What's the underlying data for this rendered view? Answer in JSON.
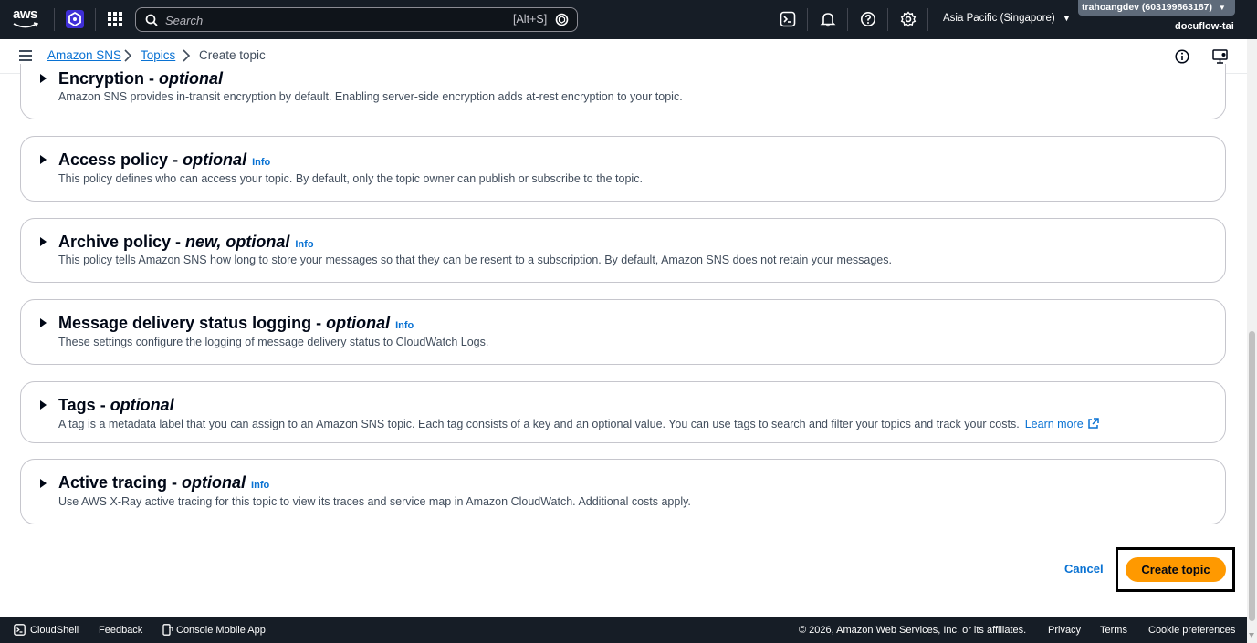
{
  "topnav": {
    "logo": "aws",
    "search_placeholder": "Search",
    "search_shortcut": "[Alt+S]",
    "region": "Asia Pacific (Singapore)",
    "account": "trahoangdev (603199863187)",
    "user": "docuflow-tai",
    "icons": [
      "cloudshell-icon",
      "bell-icon",
      "help-icon",
      "settings-icon"
    ]
  },
  "breadcrumb": {
    "items": [
      "Amazon SNS",
      "Topics"
    ],
    "current": "Create topic"
  },
  "panels": [
    {
      "title": "Encryption",
      "sep": " - ",
      "optional": "optional",
      "info": "",
      "description": "Amazon SNS provides in-transit encryption by default. Enabling server-side encryption adds at-rest encryption to your topic."
    },
    {
      "title": "Access policy",
      "sep": " - ",
      "optional": "optional",
      "info": "Info",
      "description": "This policy defines who can access your topic. By default, only the topic owner can publish or subscribe to the topic."
    },
    {
      "title": "Archive policy",
      "sep": " - ",
      "optional": "new, optional",
      "info": "Info",
      "description": "This policy tells Amazon SNS how long to store your messages so that they can be resent to a subscription. By default, Amazon SNS does not retain your messages."
    },
    {
      "title": "Message delivery status logging",
      "sep": " - ",
      "optional": "optional",
      "info": "Info",
      "description": "These settings configure the logging of message delivery status to CloudWatch Logs."
    },
    {
      "title": "Tags",
      "sep": " - ",
      "optional": "optional",
      "info": "",
      "description": "A tag is a metadata label that you can assign to an Amazon SNS topic. Each tag consists of a key and an optional value. You can use tags to search and filter your topics and track your costs.",
      "link": "Learn more"
    },
    {
      "title": "Active tracing",
      "sep": " - ",
      "optional": "optional",
      "info": "Info",
      "description": "Use AWS X-Ray active tracing for this topic to view its traces and service map in Amazon CloudWatch. Additional costs apply."
    }
  ],
  "actions": {
    "cancel": "Cancel",
    "create": "Create topic"
  },
  "footer": {
    "cloudshell": "CloudShell",
    "feedback": "Feedback",
    "mobile_app": "Console Mobile App",
    "copyright": "© 2026, Amazon Web Services, Inc. or its affiliates.",
    "privacy": "Privacy",
    "terms": "Terms",
    "cookies": "Cookie preferences"
  },
  "colors": {
    "nav_bg": "#161d26",
    "link": "#0972d3",
    "primary_button": "#ff9900",
    "panel_border": "#c6c6cd"
  }
}
